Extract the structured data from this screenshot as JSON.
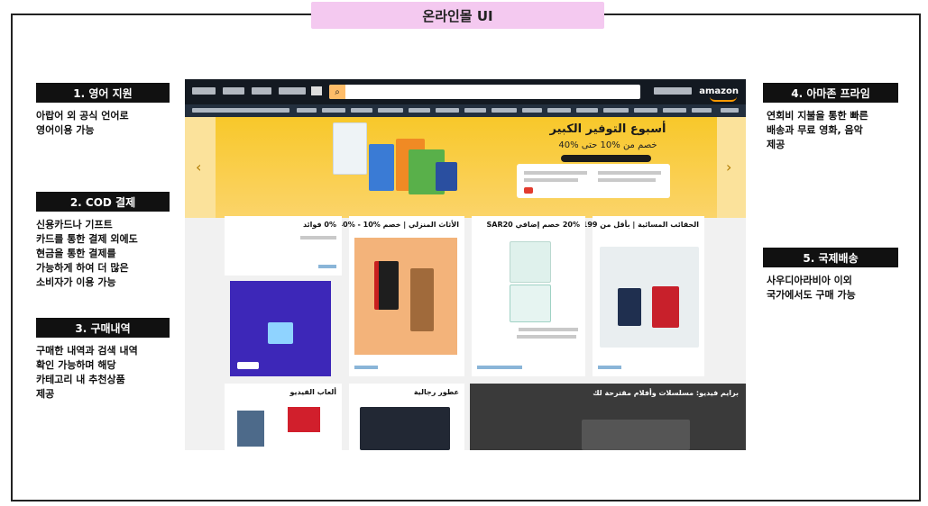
{
  "page": {
    "title": "온라인몰 UI"
  },
  "annotations": {
    "left": [
      {
        "label": "1. 영어 지원",
        "desc_lines": [
          "아랍어 외 공식 언어로",
          "영어이용 가능"
        ]
      },
      {
        "label": "2. COD 결제",
        "desc_lines": [
          "신용카드나 기프트",
          "카드를 통한 결제 외에도",
          "현금을 통한 결제를",
          "가능하게 하여 더 많은",
          "소비자가 이용 가능"
        ]
      },
      {
        "label": "3. 구매내역",
        "desc_lines": [
          "구매한 내역과 검색 내역",
          "확인 가능하며 해당",
          "카테고리 내 추천상품",
          "제공"
        ]
      }
    ],
    "right": [
      {
        "label": "4. 아마존 프라임",
        "desc_lines": [
          "연회비 지불을 통한 빠른",
          "배송과 무료 영화, 음악",
          "제공"
        ]
      },
      {
        "label": "5. 국제배송",
        "desc_lines": [
          "사우디아라비아 이외",
          "국가에서도 구매 가능"
        ]
      }
    ]
  },
  "screenshot": {
    "logo": "amazon",
    "hero": {
      "title": "أسبوع التوفير الكبير",
      "subtitle": "خصم من %10 حتى %40"
    },
    "cards": [
      {
        "title": "الحقائب المسائية | بأقل من 199 ريال"
      },
      {
        "title": "20% خصم إضافي SAR20"
      },
      {
        "title": "الأثاث المنزلي | خصم %10 - %40"
      },
      {
        "title": "0% فوائد"
      },
      {
        "title": "ألعاب الفيديو"
      },
      {
        "title": "عطور رجالية"
      },
      {
        "title": "برايم فيديو: مسلسلات وأفلام مقترحة لك"
      }
    ]
  },
  "colors": {
    "title_tab_bg": "#f4c9f0",
    "label_bg": "#111111",
    "amazon_nav": "#131921",
    "amazon_orange": "#ff9900",
    "hero_yellow": "#f8c82a"
  }
}
